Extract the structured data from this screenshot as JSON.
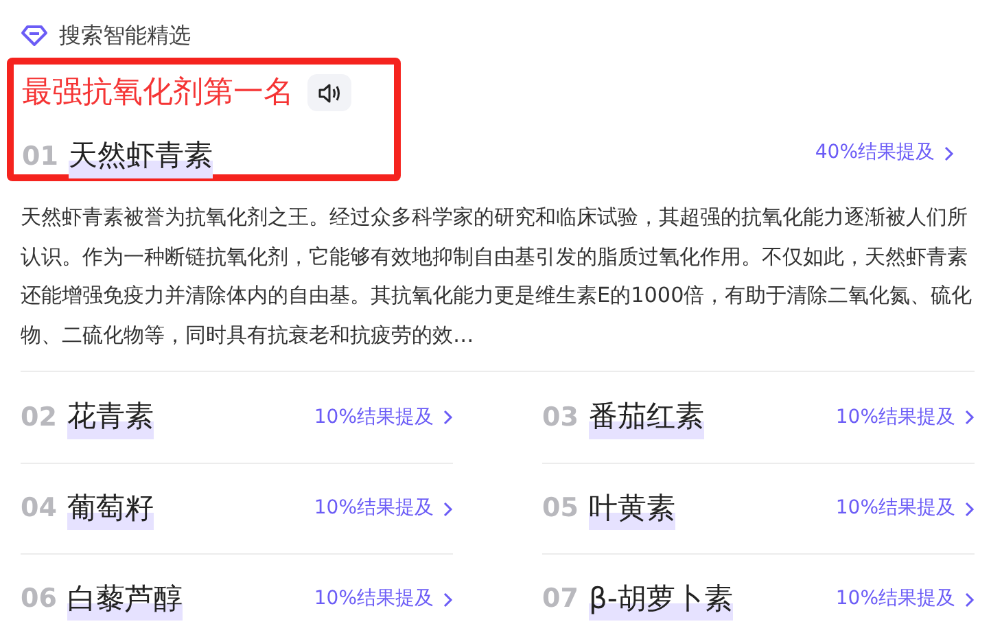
{
  "header": {
    "title": "搜索智能精选"
  },
  "highlight": {
    "title": "最强抗氧化剂第一名"
  },
  "top": {
    "rank": "01",
    "name": "天然虾青素",
    "mention": "40%结果提及",
    "description": "天然虾青素被誉为抗氧化剂之王。经过众多科学家的研究和临床试验，其超强的抗氧化能力逐渐被人们所认识。作为一种断链抗氧化剂，它能够有效地抑制自由基引发的脂质过氧化作用。不仅如此，天然虾青素还能增强免疫力并清除体内的自由基。其抗氧化能力更是维生素E的1000倍，有助于清除二氧化氮、硫化物、二硫化物等，同时具有抗衰老和抗疲劳的效…"
  },
  "items": [
    {
      "rank": "02",
      "name": "花青素",
      "mention": "10%结果提及"
    },
    {
      "rank": "03",
      "name": "番茄红素",
      "mention": "10%结果提及"
    },
    {
      "rank": "04",
      "name": "葡萄籽",
      "mention": "10%结果提及"
    },
    {
      "rank": "05",
      "name": "叶黄素",
      "mention": "10%结果提及"
    },
    {
      "rank": "06",
      "name": "白藜芦醇",
      "mention": "10%结果提及"
    },
    {
      "rank": "07",
      "name": "β-胡萝卜素",
      "mention": "10%结果提及"
    }
  ]
}
